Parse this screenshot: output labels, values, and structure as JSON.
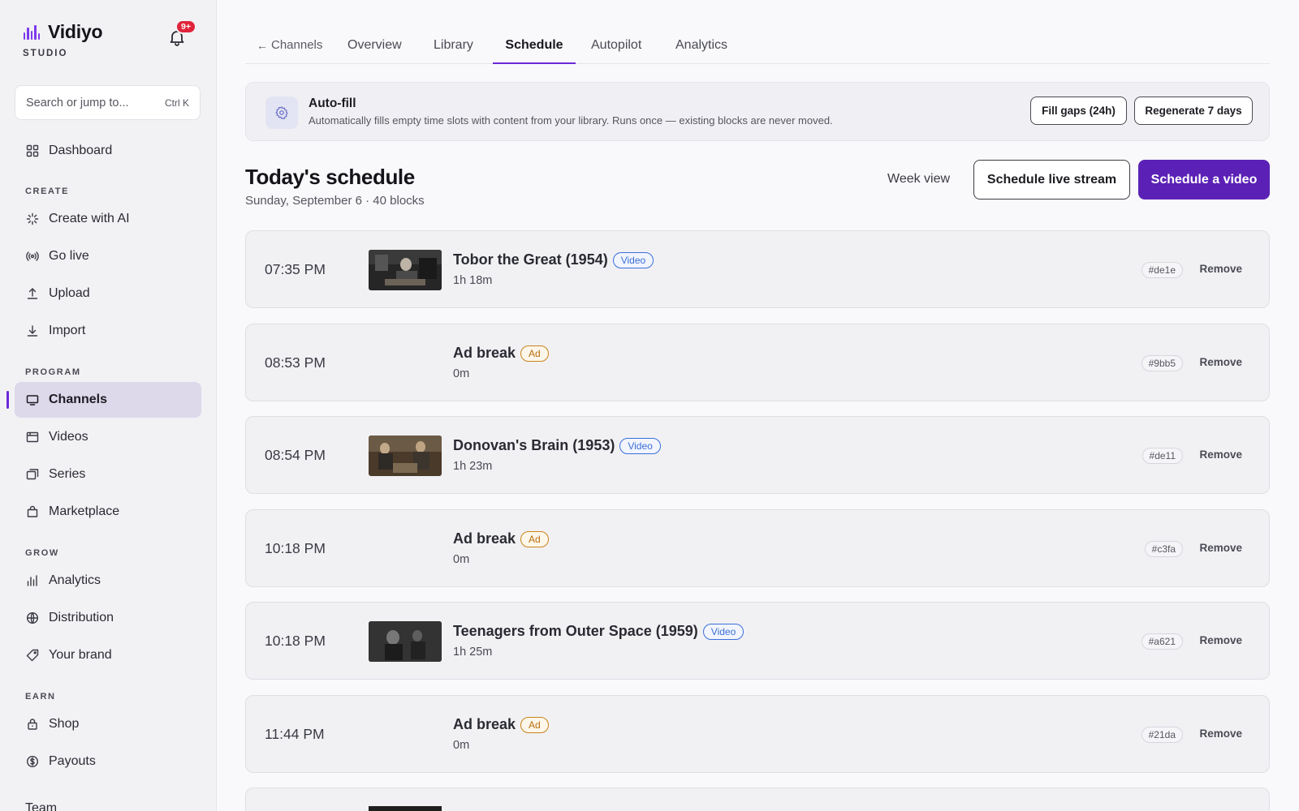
{
  "app": {
    "name": "Vidiyo",
    "subtitle": "STUDIO",
    "notifications_badge": "9+",
    "accent_color": "#5b21b6"
  },
  "sidebar": {
    "search": {
      "placeholder": "Search or jump to...",
      "shortcut": "Ctrl K"
    },
    "dashboard": {
      "label": "Dashboard",
      "icon": "grid-icon"
    },
    "sections": [
      {
        "title": "CREATE",
        "items": [
          {
            "label": "Create with AI",
            "icon": "sparkle-icon"
          },
          {
            "label": "Go live",
            "icon": "broadcast-icon"
          },
          {
            "label": "Upload",
            "icon": "upload-icon"
          },
          {
            "label": "Import",
            "icon": "download-icon"
          }
        ]
      },
      {
        "title": "PROGRAM",
        "items": [
          {
            "label": "Channels",
            "icon": "monitor-icon",
            "active": true
          },
          {
            "label": "Videos",
            "icon": "film-icon"
          },
          {
            "label": "Series",
            "icon": "stack-icon"
          },
          {
            "label": "Marketplace",
            "icon": "bag-icon"
          }
        ]
      },
      {
        "title": "GROW",
        "items": [
          {
            "label": "Analytics",
            "icon": "bars-icon"
          },
          {
            "label": "Distribution",
            "icon": "globe-icon"
          },
          {
            "label": "Your brand",
            "icon": "tag-icon"
          }
        ]
      },
      {
        "title": "EARN",
        "items": [
          {
            "label": "Shop",
            "icon": "lock-bag-icon"
          },
          {
            "label": "Payouts",
            "icon": "dollar-icon"
          }
        ]
      }
    ],
    "footer_item": "Team"
  },
  "tabs": {
    "back": "Channels",
    "items": [
      "Overview",
      "Library",
      "Schedule",
      "Autopilot",
      "Analytics"
    ],
    "active": "Schedule"
  },
  "autofill": {
    "title": "Auto-fill",
    "description": "Automatically fills empty time slots with content from your library. Runs once — existing blocks are never moved.",
    "fill_gaps_label": "Fill gaps (24h)",
    "regenerate_label": "Regenerate 7 days"
  },
  "schedule": {
    "title": "Today's schedule",
    "subtitle": "Sunday, September 6 · 40 blocks",
    "week_view_label": "Week view",
    "schedule_live_label": "Schedule live stream",
    "schedule_video_label": "Schedule a video",
    "remove_label": "Remove",
    "blocks": [
      {
        "time": "07:35 PM",
        "title": "Tobor the Great (1954)",
        "tag": "Video",
        "duration": "1h 18m",
        "id": "#de1e",
        "thumb": true
      },
      {
        "time": "08:53 PM",
        "title": "Ad break",
        "tag": "Ad",
        "duration": "0m",
        "id": "#9bb5",
        "thumb": false
      },
      {
        "time": "08:54 PM",
        "title": "Donovan's Brain (1953)",
        "tag": "Video",
        "duration": "1h 23m",
        "id": "#de11",
        "thumb": true
      },
      {
        "time": "10:18 PM",
        "title": "Ad break",
        "tag": "Ad",
        "duration": "0m",
        "id": "#c3fa",
        "thumb": false
      },
      {
        "time": "10:18 PM",
        "title": "Teenagers from Outer Space (1959)",
        "tag": "Video",
        "duration": "1h 25m",
        "id": "#a621",
        "thumb": true
      },
      {
        "time": "11:44 PM",
        "title": "Ad break",
        "tag": "Ad",
        "duration": "0m",
        "id": "#21da",
        "thumb": false
      }
    ]
  }
}
